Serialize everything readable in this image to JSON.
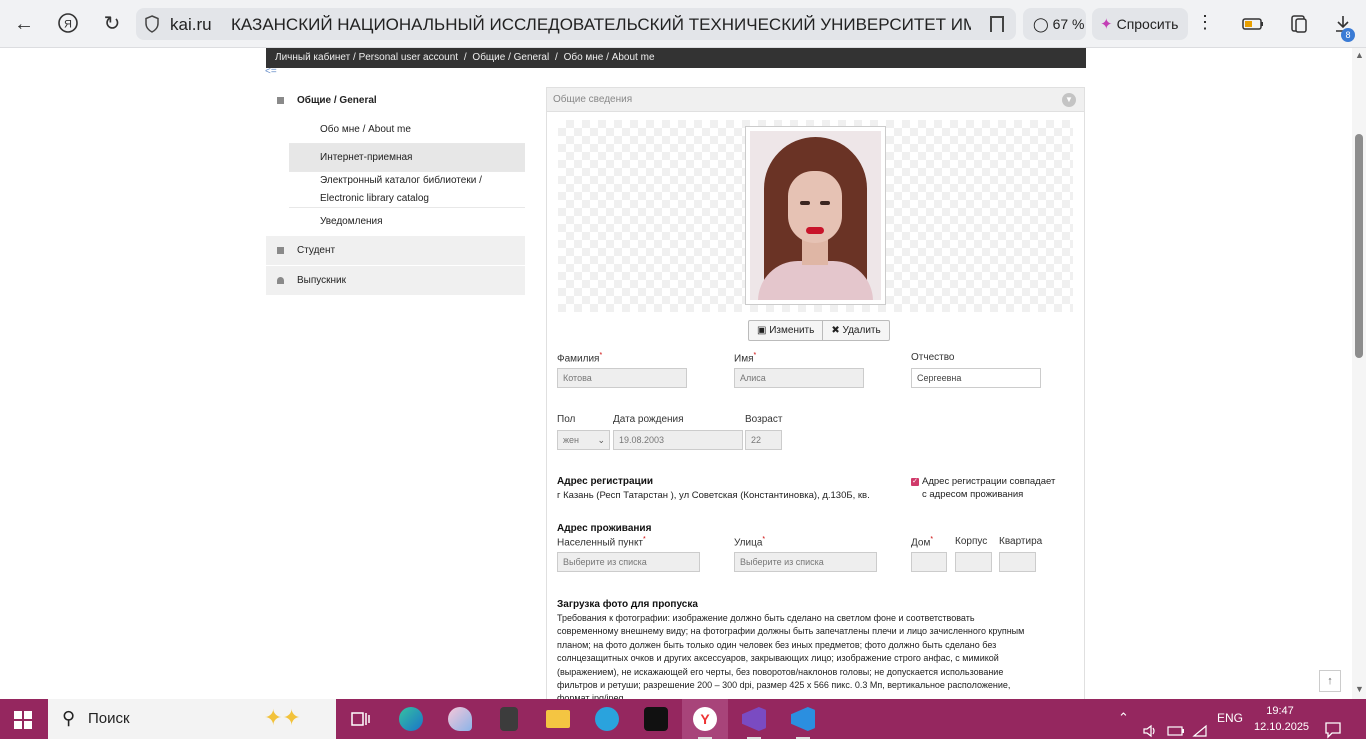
{
  "browser": {
    "domain": "kai.ru",
    "page_title": "КАЗАНСКИЙ НАЦИОНАЛЬНЫЙ ИССЛЕДОВАТЕЛЬСКИЙ ТЕХНИЧЕСКИЙ УНИВЕРСИТЕТ ИМ....",
    "zoom": "67 %",
    "ask_label": "Спросить",
    "downloads_badge": "8",
    "icons": [
      "back-icon",
      "yandex-icon",
      "reload-icon",
      "shield-icon",
      "bookmark-icon",
      "search-chat-icon",
      "sparkle-icon",
      "menu-icon",
      "battery-icon",
      "collections-icon",
      "download-icon"
    ]
  },
  "breadcrumb": {
    "items": [
      "Личный кабинет / Personal user account",
      "Общие / General",
      "Обо мне / About me"
    ],
    "separator": "/"
  },
  "menu": {
    "collapse_symbol": "<=",
    "general_label": "Общие / General",
    "sub_items": [
      {
        "label": "Обо мне / About me"
      },
      {
        "label": "Интернет-приемная"
      },
      {
        "label_line1": "Электронный каталог библиотеки /",
        "label_line2": "Electronic library catalog"
      },
      {
        "label": "Уведомления"
      }
    ],
    "student_label": "Студент",
    "graduate_label": "Выпускник"
  },
  "panel": {
    "header": "Общие сведения",
    "change_btn": "Изменить",
    "delete_btn": "Удалить",
    "fields": {
      "surname_label": "Фамилия",
      "surname_value": "Котова",
      "name_label": "Имя",
      "name_value": "Алиса",
      "patronymic_label": "Отчество",
      "patronymic_value": "Сергеевна",
      "sex_label": "Пол",
      "sex_value": "жен",
      "birth_label": "Дата рождения",
      "birth_value": "19.08.2003",
      "age_label": "Возраст",
      "age_value": "22",
      "required_mark": "*"
    },
    "registration": {
      "title": "Адрес регистрации",
      "address": "г Казань (Респ Татарстан ), ул Советская (Константиновка), д.130Б, кв.",
      "same_line1": "Адрес регистрации совпадает",
      "same_line2": "с адресом проживания",
      "same_checked": true
    },
    "residence": {
      "title": "Адрес проживания",
      "locality_label": "Населенный пункт",
      "locality_placeholder": "Выберите из списка",
      "street_label": "Улица",
      "street_placeholder": "Выберите из списка",
      "house_label": "Дом",
      "building_label": "Корпус",
      "apt_label": "Квартира"
    },
    "pass_photo": {
      "title": "Загрузка фото для пропуска",
      "lines": [
        "Требования к фотографии: изображение должно быть сделано на светлом фоне и соответствовать",
        "современному внешнему виду; на фотографии должны быть запечатлены плечи и лицо зачисленного крупным",
        "планом; на фото должен быть только один человек без иных предметов; фото должно быть сделано без",
        "солнцезащитных очков и других аксессуаров, закрывающих лицо; изображение строго анфас, с мимикой",
        "(выражением), не искажающей его черты, без поворотов/наклонов головы; не допускается использование",
        "фильтров и ретуши; разрешение 200 – 300 dpi, размер 425 x 566 пикс. 0.3 Мп, вертикальное расположение,",
        "формат jpg/jpeg."
      ]
    }
  },
  "taskbar": {
    "search_placeholder": "Поиск",
    "lang": "ENG",
    "time": "19:47",
    "date": "12.10.2025",
    "apps": [
      "task-view-icon",
      "edge-icon",
      "paint-icon",
      "calculator-icon",
      "explorer-icon",
      "telegram-icon",
      "figma-icon",
      "yandex-browser-icon",
      "visual-studio-icon",
      "vscode-icon"
    ],
    "colors": {
      "taskbar": "#95275f",
      "active": "#a8447a"
    }
  }
}
